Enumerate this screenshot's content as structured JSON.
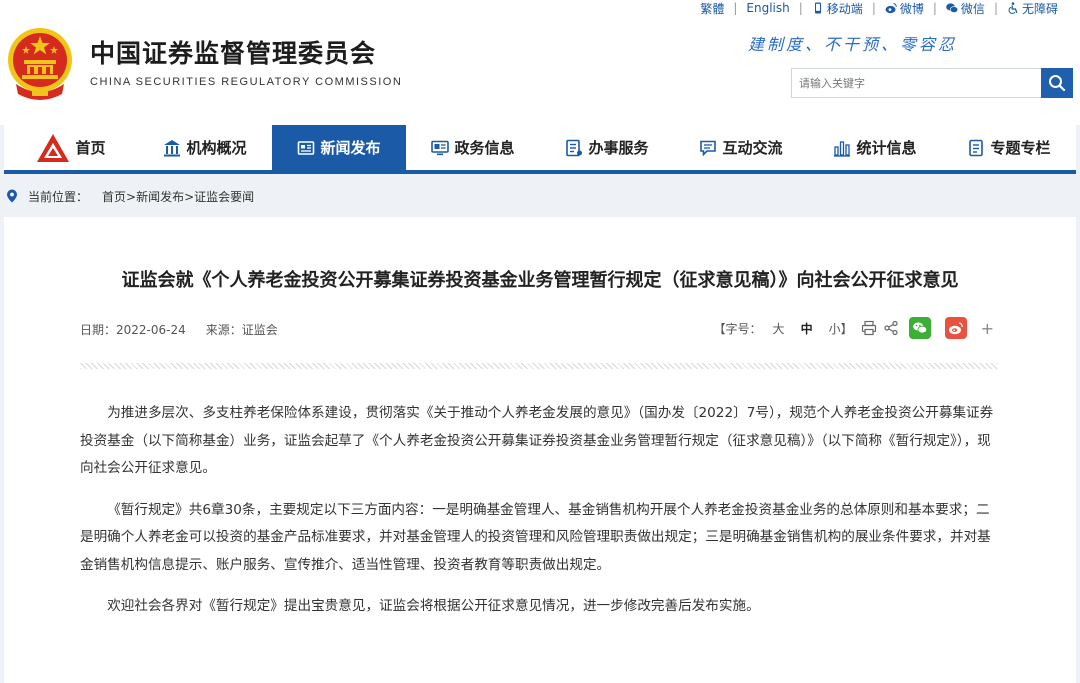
{
  "header": {
    "site_name_cn": "中国证券监督管理委员会",
    "site_name_en": "CHINA SECURITIES REGULATORY COMMISSION",
    "slogan": "建制度、不干预、零容忍",
    "top_links": {
      "traditional": "繁體",
      "english": "English",
      "mobile": "移动端",
      "weibo": "微博",
      "wechat": "微信",
      "accessibility": "无障碍"
    },
    "search": {
      "placeholder": "请输入关键字"
    }
  },
  "nav": {
    "items": [
      {
        "label": "首页",
        "icon": "csrc-logo-icon"
      },
      {
        "label": "机构概况",
        "icon": "building-icon"
      },
      {
        "label": "新闻发布",
        "icon": "newspaper-icon",
        "active": true
      },
      {
        "label": "政务信息",
        "icon": "monitor-icon"
      },
      {
        "label": "办事服务",
        "icon": "document-list-icon"
      },
      {
        "label": "互动交流",
        "icon": "chat-icon"
      },
      {
        "label": "统计信息",
        "icon": "bar-chart-icon"
      },
      {
        "label": "专题专栏",
        "icon": "notebook-icon"
      }
    ]
  },
  "breadcrumb": {
    "label": "当前位置：",
    "path": "首页>新闻发布>证监会要闻"
  },
  "article": {
    "title": "证监会就《个人养老金投资公开募集证券投资基金业务管理暂行规定（征求意见稿）》向社会公开征求意见",
    "date_label": "日期：2022-06-24",
    "source_label": "来源：证监会",
    "font_size": {
      "label": "【字号：",
      "large": "大",
      "medium": "中",
      "small": "小】"
    },
    "paragraphs": [
      "为推进多层次、多支柱养老保险体系建设，贯彻落实《关于推动个人养老金发展的意见》（国办发〔2022〕7号），规范个人养老金投资公开募集证券投资基金（以下简称基金）业务，证监会起草了《个人养老金投资公开募集证券投资基金业务管理暂行规定（征求意见稿）》（以下简称《暂行规定》），现向社会公开征求意见。",
      "《暂行规定》共6章30条，主要规定以下三方面内容：一是明确基金管理人、基金销售机构开展个人养老金投资基金业务的总体原则和基本要求；二是明确个人养老金可以投资的基金产品标准要求，并对基金管理人的投资管理和风险管理职责做出规定；三是明确基金销售机构的展业条件要求，并对基金销售机构信息提示、账户服务、宣传推介、适当性管理、投资者教育等职责做出规定。",
      "欢迎社会各界对《暂行规定》提出宝贵意见，证监会将根据公开征求意见情况，进一步修改完善后发布实施。"
    ]
  },
  "colors": {
    "brand_blue": "#1b5aa6",
    "emblem_red": "#d62a1e",
    "emblem_gold": "#f0c419",
    "wechat_green": "#3cb034",
    "weibo_red": "#e8523f"
  }
}
